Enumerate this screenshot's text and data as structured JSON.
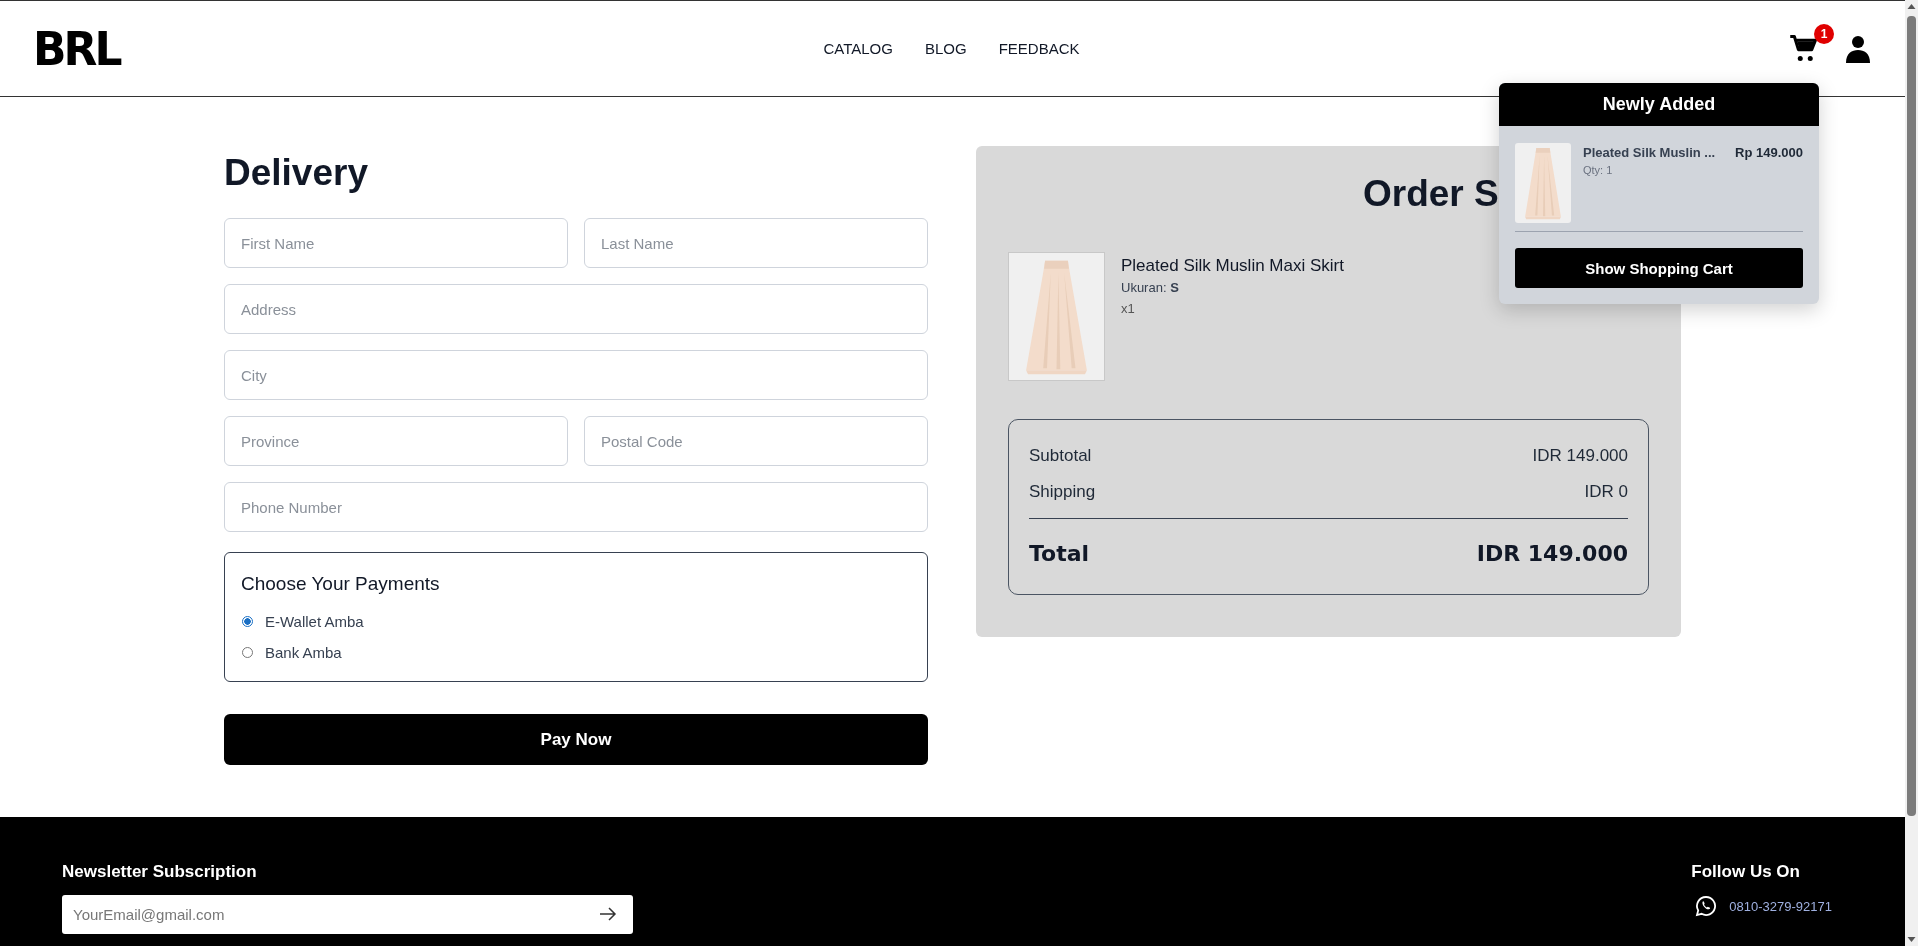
{
  "header": {
    "logo": "BRL",
    "nav": [
      {
        "label": "CATALOG"
      },
      {
        "label": "BLOG"
      },
      {
        "label": "FEEDBACK"
      }
    ],
    "cart_badge": "1"
  },
  "cart_popup": {
    "title": "Newly Added",
    "items": [
      {
        "name": "Pleated Silk Muslin ...",
        "qty": "Qty: 1",
        "price": "Rp 149.000"
      }
    ],
    "button": "Show Shopping Cart"
  },
  "delivery": {
    "title": "Delivery",
    "field_rows": [
      [
        {
          "placeholder": "First Name"
        },
        {
          "placeholder": "Last Name"
        }
      ],
      [
        {
          "placeholder": "Address"
        }
      ],
      [
        {
          "placeholder": "City"
        }
      ],
      [
        {
          "placeholder": "Province"
        },
        {
          "placeholder": "Postal Code"
        }
      ],
      [
        {
          "placeholder": "Phone Number"
        }
      ]
    ],
    "payments": {
      "title": "Choose Your Payments",
      "options": [
        {
          "label": "E-Wallet Amba",
          "selected": true
        },
        {
          "label": "Bank Amba",
          "selected": false
        }
      ]
    },
    "pay_button": "Pay Now"
  },
  "order_summary": {
    "title": "Order S",
    "items": [
      {
        "name": "Pleated Silk Muslin Maxi Skirt",
        "size": "Ukuran: **S**",
        "quantity": "x1"
      }
    ],
    "lines": [
      {
        "label": "Subtotal",
        "value": "IDR 149.000"
      },
      {
        "label": "Shipping",
        "value": "IDR 0"
      }
    ],
    "total": {
      "label": "Total",
      "value": "IDR 149.000"
    }
  },
  "footer": {
    "newsletter": {
      "title": "Newsletter Subscription",
      "placeholder": "YourEmail@gmail.com"
    },
    "follow": {
      "title": "Follow Us On",
      "phone": "0810-3279-92171"
    }
  }
}
